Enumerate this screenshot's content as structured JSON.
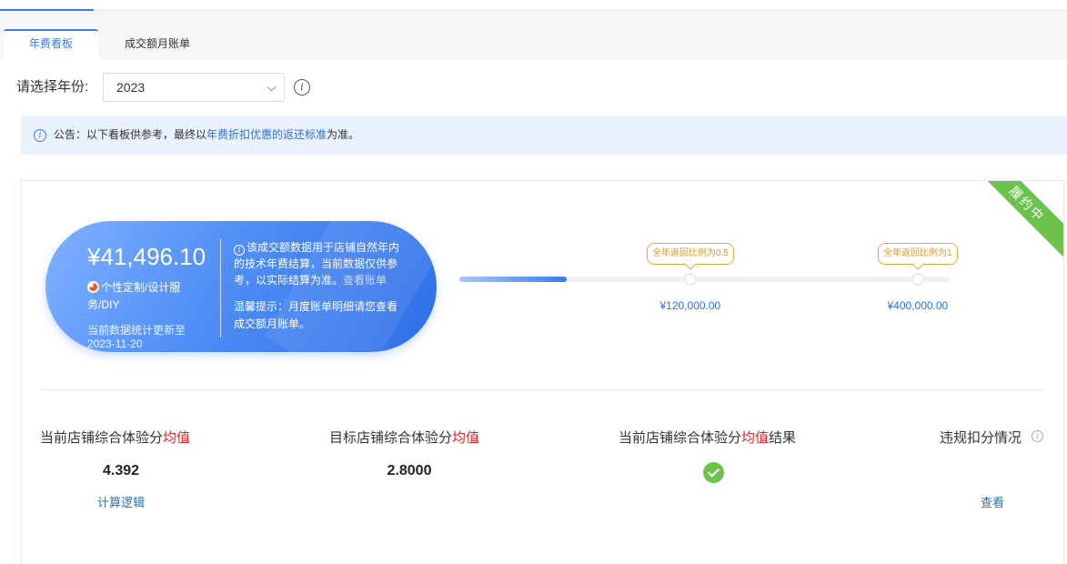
{
  "tabs": [
    {
      "label": "年费看板",
      "active": true
    },
    {
      "label": "成交额月账单",
      "active": false
    }
  ],
  "filter": {
    "year_label": "请选择年份:",
    "year_value": "2023"
  },
  "notice": {
    "prefix": "公告：以下看板供参考，最终以",
    "link": "年费折扣优惠的返还标准",
    "suffix": "为准。"
  },
  "status_ribbon": "履约中",
  "summary": {
    "amount": "¥41,496.10",
    "service": "个性定制/设计服务/DIY",
    "update_label": "当前数据统计更新至",
    "update_date": "2023-11-20",
    "desc": "该成交额数据用于店铺自然年内的技术年费结算，当前数据仅供参考，以实际结算为准。",
    "view_link": "查看账单",
    "tip": "温馨提示：月度账单明细请您查看成交额月账单。"
  },
  "progress": {
    "current": 41496.1,
    "max": 400000,
    "milestones": [
      {
        "amount": 120000,
        "amount_label": "¥120,000.00",
        "bubble": "全年返回比例为0.5"
      },
      {
        "amount": 400000,
        "amount_label": "¥400,000.00",
        "bubble": "全年返回比例为1"
      }
    ]
  },
  "metrics": {
    "current_avg": {
      "title_prefix": "当前店铺综合体验分",
      "title_red": "均值",
      "value": "4.392",
      "link": "计算逻辑"
    },
    "target_avg": {
      "title_prefix": "目标店铺综合体验分",
      "title_red": "均值",
      "value": "2.8000"
    },
    "result": {
      "title_prefix": "当前店铺综合体验分",
      "title_red": "均值",
      "title_suffix": "结果"
    },
    "violation": {
      "title": "违规扣分情况",
      "link": "查看"
    }
  },
  "colors": {
    "accent": "#3a7bf2",
    "ribbon": "#6cc24a",
    "highlight_red": "#d9262c",
    "bubble_orange": "#e8a53c"
  }
}
